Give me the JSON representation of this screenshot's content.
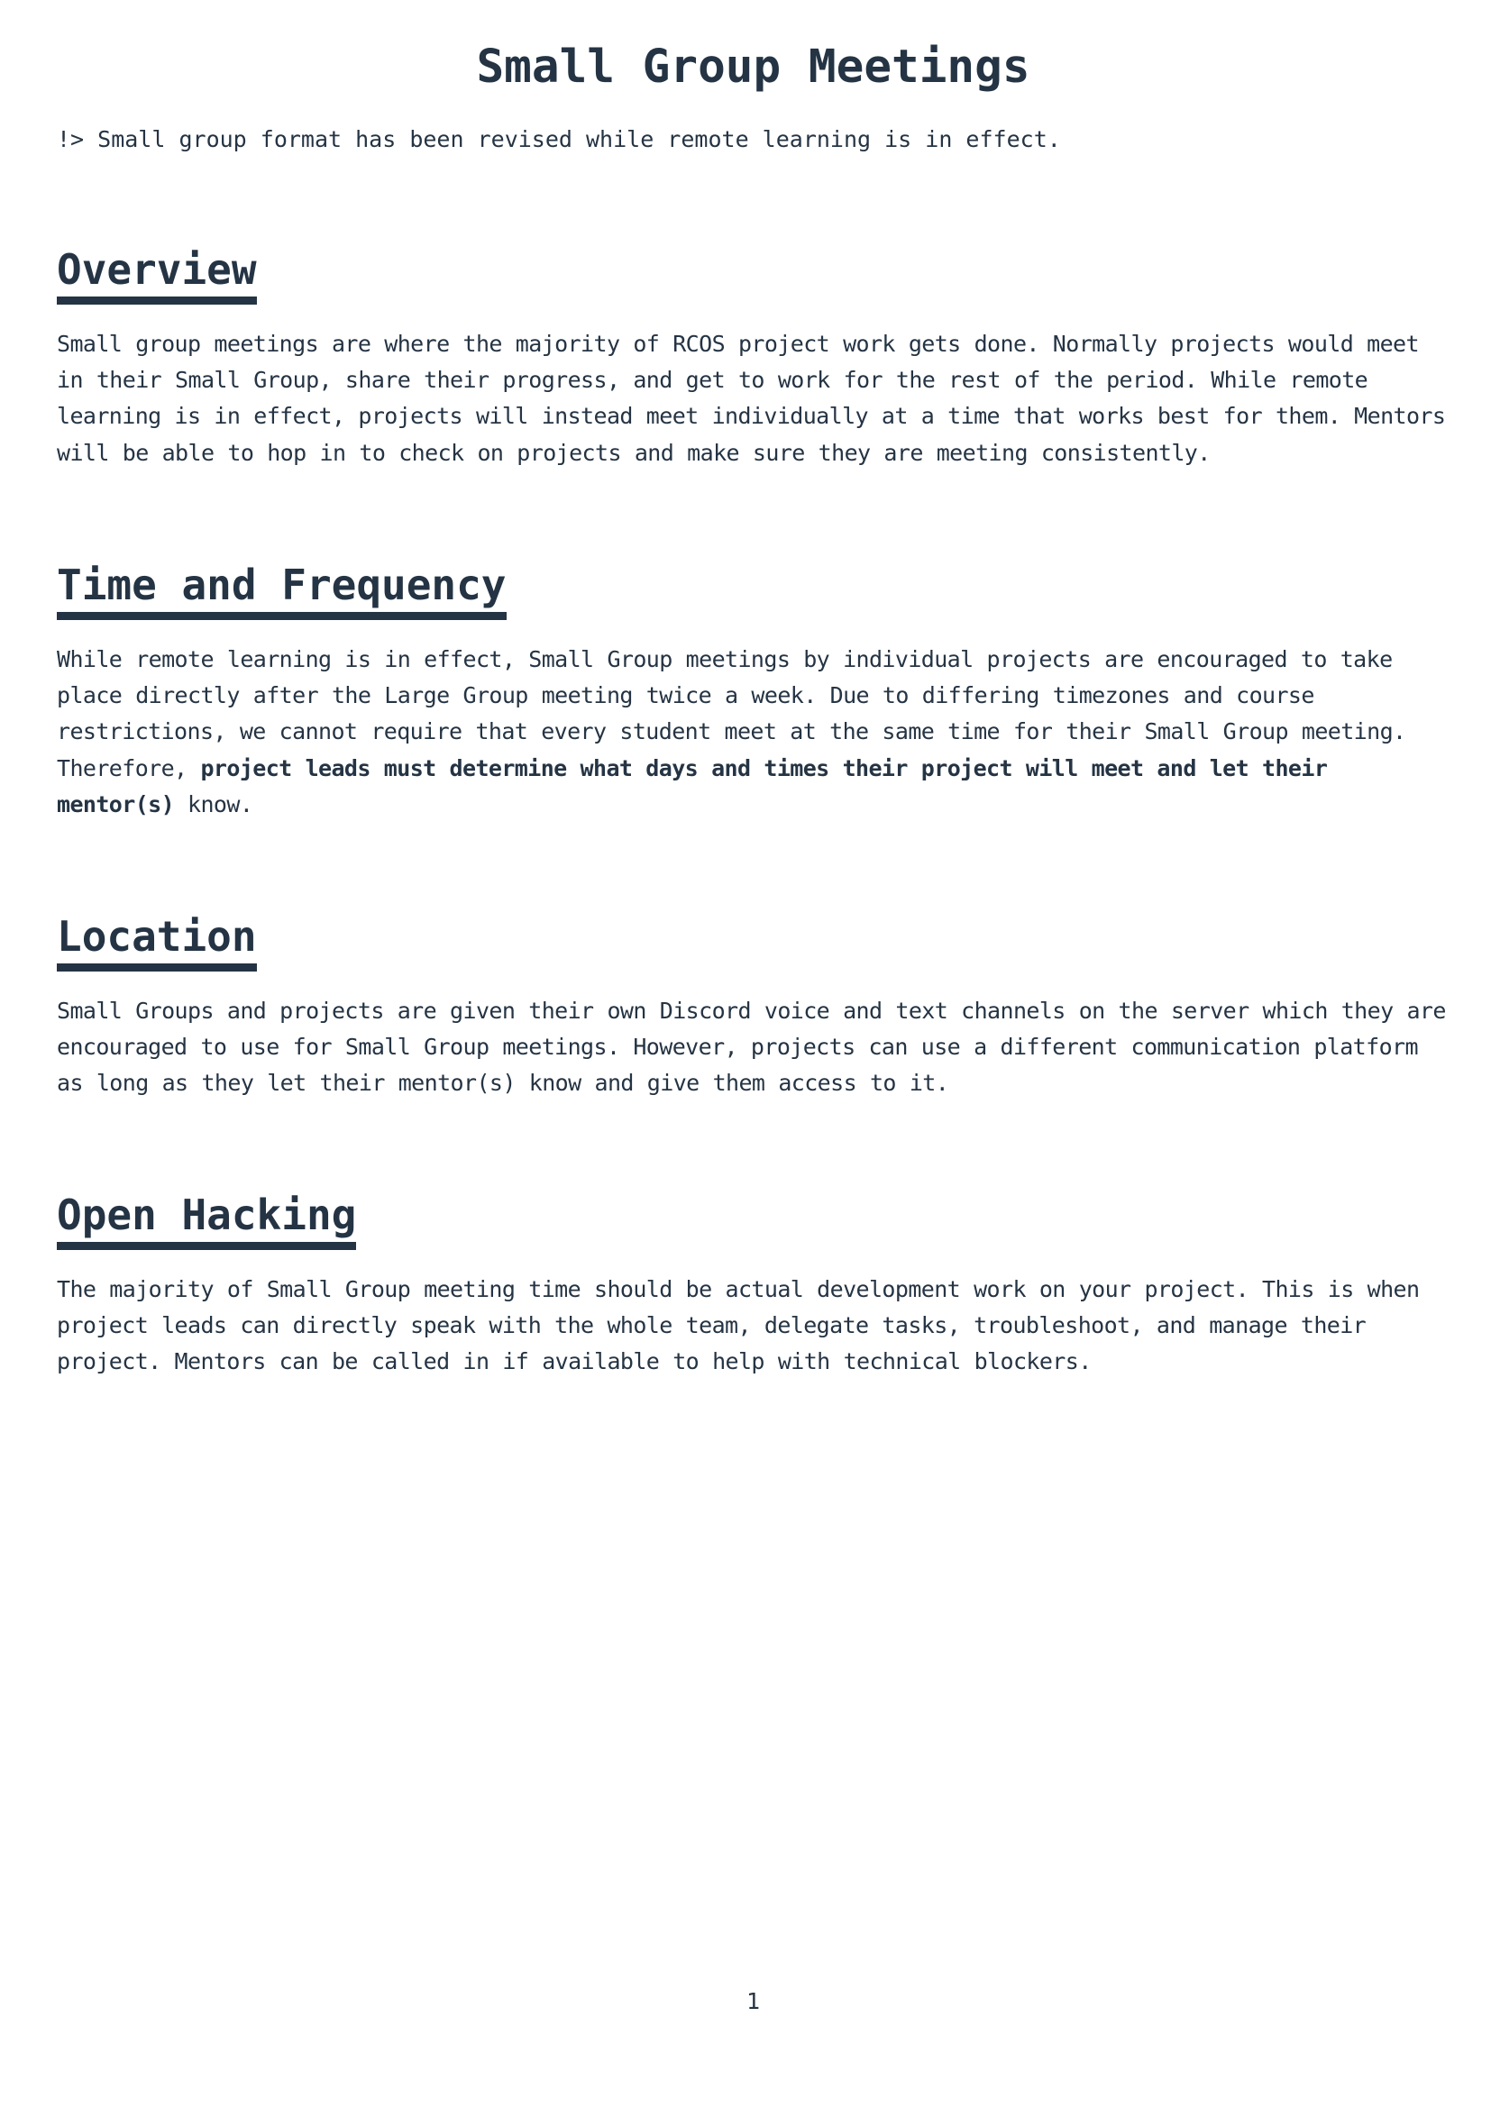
{
  "document": {
    "title": "Small Group Meetings",
    "note": "!> Small group format has been revised while remote learning is in effect.",
    "page_number": "1"
  },
  "sections": {
    "overview": {
      "heading": "Overview",
      "body": "Small group meetings are where the majority of RCOS project work gets done. Normally projects would meet in their Small Group, share their progress, and get to work for the rest of the period. While remote learning is in effect, projects will instead meet individually at a time that works best for them. Mentors will be able to hop in to check on projects and make sure they are meeting consistently."
    },
    "time": {
      "heading": "Time and Frequency",
      "body_start": "While remote learning is in effect, Small Group meetings by individual projects are encouraged to take place directly after the Large Group meeting twice a week. Due to differing timezones and course restrictions, we cannot require that every student meet at the same time for their Small Group meeting. Therefore, ",
      "body_bold": "project leads must determine what days and times their project will meet and let their mentor(s)",
      "body_end": " know."
    },
    "location": {
      "heading": "Location",
      "body": "Small Groups and projects are given their own Discord voice and text channels on the server which they are encouraged to use for Small Group meetings. However, projects can use a different communication platform as long as they let their mentor(s) know and give them access to it."
    },
    "hacking": {
      "heading": "Open Hacking",
      "body": "The majority of Small Group meeting time should be actual development work on your project. This is when project leads can directly speak with the whole team, delegate tasks, troubleshoot, and manage their project. Mentors can be called in if available to help with technical blockers."
    }
  }
}
